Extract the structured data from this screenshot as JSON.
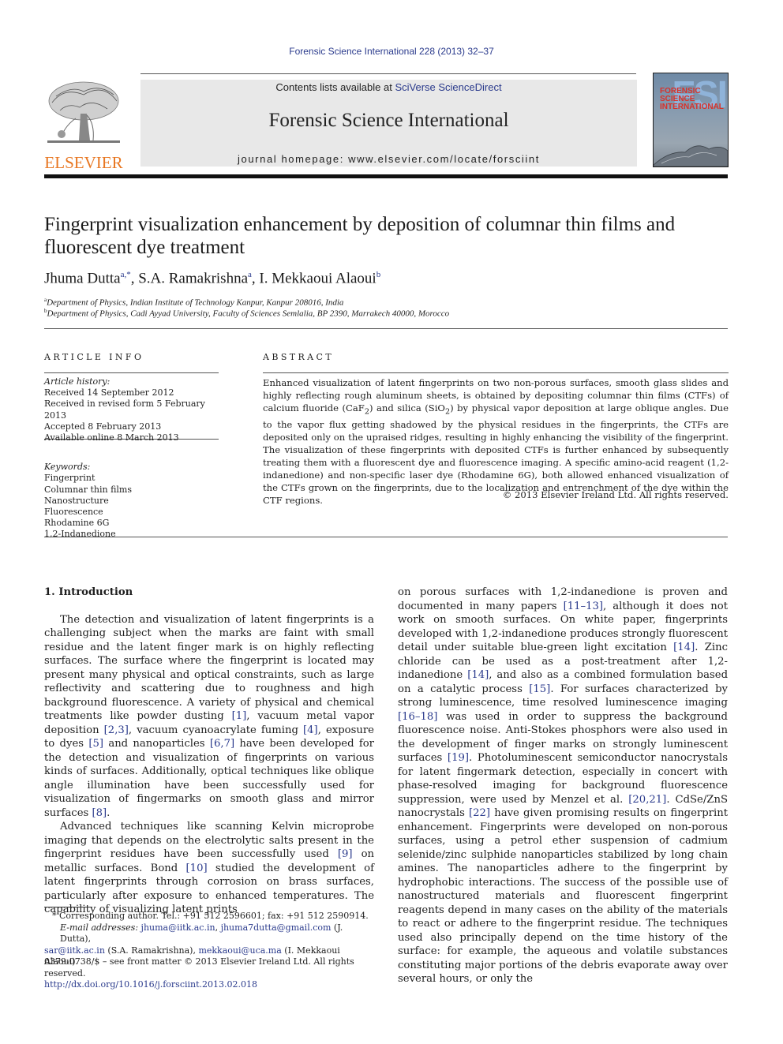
{
  "journal_ref": "Forensic Science International 228 (2013) 32–37",
  "header": {
    "publisher": "ELSEVIER",
    "contents_prefix": "Contents lists available at ",
    "contents_link": "SciVerse ScienceDirect",
    "journal_title": "Forensic Science International",
    "homepage": "journal homepage: www.elsevier.com/locate/forsciint",
    "cover_letters": "FSI",
    "cover_title_lines": [
      "FORENSIC",
      "SCIENCE",
      "INTERNATIONAL"
    ]
  },
  "article": {
    "title": "Fingerprint visualization enhancement by deposition of columnar thin films and fluorescent dye treatment",
    "authors": [
      {
        "name": "Jhuma Dutta",
        "sup": "a,*"
      },
      {
        "name": "S.A. Ramakrishna",
        "sup": "a"
      },
      {
        "name": "I. Mekkaoui Alaoui",
        "sup": "b"
      }
    ],
    "affiliations": [
      {
        "mark": "a",
        "text": "Department of Physics, Indian Institute of Technology Kanpur, Kanpur 208016, India"
      },
      {
        "mark": "b",
        "text": "Department of Physics, Cadi Ayyad University, Faculty of Sciences Semlalia, BP 2390, Marrakech 40000, Morocco"
      }
    ]
  },
  "article_info": {
    "label": "ARTICLE INFO",
    "history_label": "Article history:",
    "history": [
      "Received 14 September 2012",
      "Received in revised form 5 February 2013",
      "Accepted 8 February 2013",
      "Available online 8 March 2013"
    ],
    "keywords_label": "Keywords:",
    "keywords": [
      "Fingerprint",
      "Columnar thin films",
      "Nanostructure",
      "Fluorescence",
      "Rhodamine 6G",
      "1,2-Indanedione"
    ]
  },
  "abstract": {
    "label": "ABSTRACT",
    "text_1": "Enhanced visualization of latent fingerprints on two non-porous surfaces, smooth glass slides and highly reflecting rough aluminum sheets, is obtained by depositing columnar thin films (CTFs) of calcium fluoride (CaF",
    "sub_1": "2",
    "text_2": ") and silica (SiO",
    "sub_2": "2",
    "text_3": ") by physical vapor deposition at large oblique angles. Due to the vapor flux getting shadowed by the physical residues in the fingerprints, the CTFs are deposited only on the upraised ridges, resulting in highly enhancing the visibility of the fingerprint. The visualization of these fingerprints with deposited CTFs is further enhanced by subsequently treating them with a fluorescent dye and fluorescence imaging. A specific amino-acid reagent (1,2-indanedione) and non-specific laser dye (Rhodamine 6G), both allowed enhanced visualization of the CTFs grown on the fingerprints, due to the localization and entrenchment of the dye within the CTF regions.",
    "copyright": "© 2013 Elsevier Ireland Ltd. All rights reserved."
  },
  "body": {
    "intro_heading": "1.  Introduction",
    "p1": [
      {
        "t": "The detection and visualization of latent fingerprints is a challenging subject when the marks are faint with small residue and the latent finger mark is on highly reflecting surfaces. The surface where the fingerprint is located may present many physical and optical constraints, such as large reflectivity and scattering due to roughness and high background fluorescence. A variety of physical and chemical treatments like powder dusting "
      },
      {
        "ref": "[1]"
      },
      {
        "t": ", vacuum metal vapor deposition "
      },
      {
        "ref": "[2,3]"
      },
      {
        "t": ", vacuum cyanoacrylate fuming "
      },
      {
        "ref": "[4]"
      },
      {
        "t": ", exposure to dyes "
      },
      {
        "ref": "[5]"
      },
      {
        "t": " and nanoparticles "
      },
      {
        "ref": "[6,7]"
      },
      {
        "t": " have been developed for the detection and visualization of fingerprints on various kinds of surfaces. Additionally, optical techniques like oblique angle illumination have been successfully used for visualization of fingermarks on smooth glass and mirror surfaces "
      },
      {
        "ref": "[8]"
      },
      {
        "t": "."
      }
    ],
    "p2": [
      {
        "t": "Advanced techniques like scanning Kelvin microprobe imaging that depends on the electrolytic salts present in the fingerprint residues have been successfully used "
      },
      {
        "ref": "[9]"
      },
      {
        "t": " on metallic surfaces. Bond "
      },
      {
        "ref": "[10]"
      },
      {
        "t": " studied the development of latent fingerprints through corrosion on brass surfaces, particularly after exposure to enhanced temperatures. The capability of visualizing latent prints"
      }
    ],
    "p3": [
      {
        "t": "on porous surfaces with 1,2-indanedione is proven and documented in many papers "
      },
      {
        "ref": "[11–13]"
      },
      {
        "t": ", although it does not work on smooth surfaces. On white paper, fingerprints developed with 1,2-indanedione produces strongly fluorescent detail under suitable blue-green light excitation "
      },
      {
        "ref": "[14]"
      },
      {
        "t": ". Zinc chloride can be used as a post-treatment after 1,2-indanedione "
      },
      {
        "ref": "[14]"
      },
      {
        "t": ", and also as a combined formulation based on a catalytic process "
      },
      {
        "ref": "[15]"
      },
      {
        "t": ". For surfaces characterized by strong luminescence, time resolved luminescence imaging "
      },
      {
        "ref": "[16–18]"
      },
      {
        "t": " was used in order to suppress the background fluorescence noise. Anti-Stokes phosphors were also used in the development of finger marks on strongly luminescent surfaces "
      },
      {
        "ref": "[19]"
      },
      {
        "t": ". Photoluminescent semiconductor nanocrystals for latent fingermark detection, especially in concert with phase-resolved imaging for background fluorescence suppression, were used by Menzel et al. "
      },
      {
        "ref": "[20,21]"
      },
      {
        "t": ". CdSe/ZnS nanocrystals "
      },
      {
        "ref": "[22]"
      },
      {
        "t": " have given promising results on fingerprint enhancement. Fingerprints were developed on non-porous surfaces, using a petrol ether suspension of cadmium selenide/zinc sulphide nanoparticles stabilized by long chain amines. The nanoparticles adhere to the fingerprint by hydrophobic interactions. The success of the possible use of nanostructured materials and fluorescent fingerprint reagents depend in many cases on the ability of the materials to react or adhere to the fingerprint residue. The techniques used also principally depend on the time history of the surface: for example, the aqueous and volatile substances constituting major portions of the debris evaporate away over several hours, or only the"
      }
    ]
  },
  "footnotes": {
    "corresponding": "* Corresponding author. Tel.: +91 512 2596601; fax: +91 512 2590914.",
    "email_label": "E-mail addresses:",
    "email_1": "jhuma@iitk.ac.in",
    "email_2": "jhuma7dutta@gmail.com",
    "email_12_owner": " (J. Dutta),",
    "email_3": "sar@iitk.ac.in",
    "email_3_owner": " (S.A. Ramakrishna), ",
    "email_4": "mekkaoui@uca.ma",
    "email_4_owner": " (I. Mekkaoui Alaoui)."
  },
  "front_matter": {
    "issn_line": "0379-0738/$ – see front matter © 2013 Elsevier Ireland Ltd. All rights reserved.",
    "doi": "http://dx.doi.org/10.1016/j.forsciint.2013.02.018"
  },
  "colors": {
    "link": "#2a3a8c",
    "elsevier_orange": "#e87722",
    "header_box": "#e8e8e8"
  }
}
